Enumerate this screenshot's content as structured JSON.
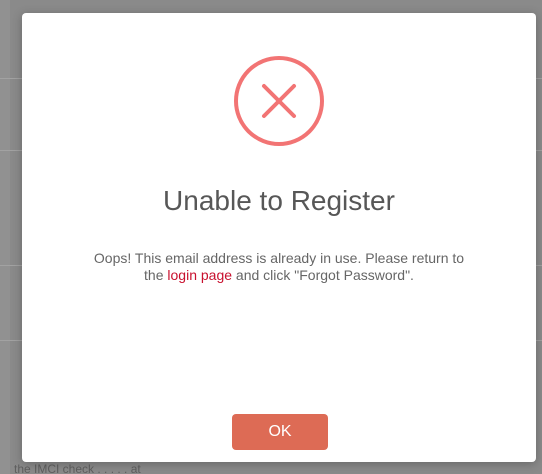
{
  "modal": {
    "icon": "error-x-circle-icon",
    "title": "Unable to Register",
    "message_line1": "Oops! This email address is already in use. Please return to",
    "message_the": "the ",
    "login_link": "login page",
    "message_tail": " and click \"Forgot Password\".",
    "ok_label": "OK"
  },
  "background": {
    "footer_text": "the IMCI check . . . . . at"
  },
  "colors": {
    "icon_stroke": "#f27474",
    "button": "#dd6b55",
    "link": "#c8102e",
    "title": "#575757",
    "text": "#666666"
  }
}
